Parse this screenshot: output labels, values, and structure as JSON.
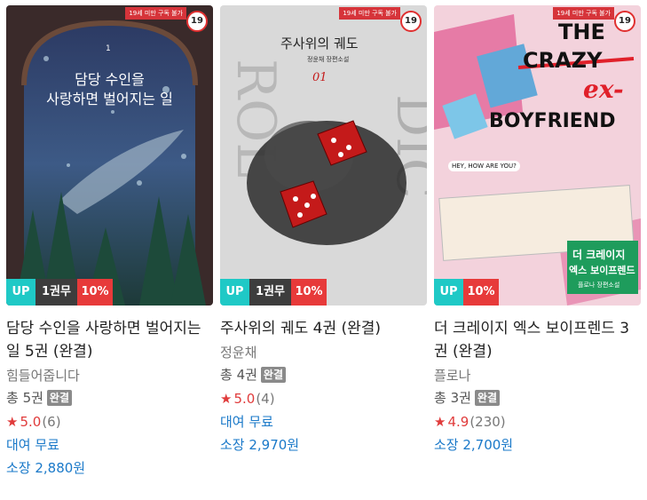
{
  "cards": [
    {
      "age_strip": "19세 미만 구독 불가",
      "age_badge": "19",
      "cover_title_line1": "담당 수인을",
      "cover_title_line2": "사랑하면 벌어지는 일",
      "cover_volume": "1",
      "badges": {
        "up": "UP",
        "volume": "1권무",
        "discount": "10%"
      },
      "title": "담당 수인을 사랑하면 벌어지는 일 5권 (완결)",
      "author": "힘들어줍니다",
      "total": "총 5권",
      "complete": "완결",
      "rating": "5.0",
      "rating_count": "(6)",
      "rent": "대여 무료",
      "buy": "소장 2,880원"
    },
    {
      "age_strip": "19세 미만 구독 불가",
      "age_badge": "19",
      "cover_title": "주사위의 궤도",
      "cover_subtitle": "정윤채 장편소설",
      "cover_volume": "01",
      "badges": {
        "up": "UP",
        "volume": "1권무",
        "discount": "10%"
      },
      "title": "주사위의 궤도 4권 (완결)",
      "author": "정윤채",
      "total": "총 4권",
      "complete": "완결",
      "rating": "5.0",
      "rating_count": "(4)",
      "rent": "대여 무료",
      "buy": "소장 2,970원"
    },
    {
      "age_strip": "19세 미만 구독 불가",
      "age_badge": "19",
      "cover_the": "THE",
      "cover_crazy": "CRAZY",
      "cover_ex": "ex-",
      "cover_boyfriend": "BOYFRIEND",
      "cover_hey": "HEY, HOW ARE YOU?",
      "cover_kor_line1": "더 크레이지",
      "cover_kor_line2": "엑스 보이프렌드",
      "cover_kor_sub": "플로나 장편소설",
      "badges": {
        "up": "UP",
        "discount": "10%"
      },
      "title": "더 크레이지 엑스 보이프렌드 3권 (완결)",
      "author": "플로나",
      "total": "총 3권",
      "complete": "완결",
      "rating": "4.9",
      "rating_count": "(230)",
      "rent": "",
      "buy": "소장 2,700원"
    }
  ],
  "colors": {
    "up": "#1fc9c6",
    "discount": "#e73a3a",
    "link": "#1a79c9",
    "star": "#e03b3b"
  }
}
